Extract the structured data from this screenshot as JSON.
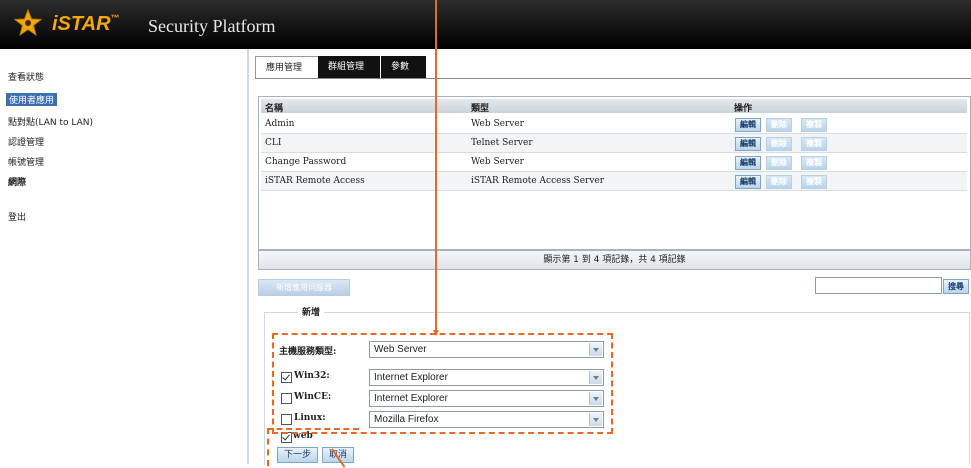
{
  "app": {
    "brand": "iSTAR",
    "tm": "™",
    "product": "Security Platform"
  },
  "sidebar": {
    "items": [
      {
        "label": "查看狀態"
      },
      {
        "label": "使用者應用"
      },
      {
        "label": "點對點(LAN to LAN)"
      },
      {
        "label": "認證管理"
      },
      {
        "label": "帳號管理"
      },
      {
        "label": "網際"
      },
      {
        "label": "登出"
      }
    ]
  },
  "tabs": [
    {
      "label": "應用管理"
    },
    {
      "label": "群組管理"
    },
    {
      "label": "參數"
    }
  ],
  "table": {
    "headers": [
      "名稱",
      "類型",
      "操作"
    ],
    "rows": [
      {
        "name": "Admin",
        "type": "Web Server"
      },
      {
        "name": "CLI",
        "type": "Telnet Server"
      },
      {
        "name": "Change Password",
        "type": "Web Server"
      },
      {
        "name": "iSTAR Remote Access",
        "type": "iSTAR Remote Access Server"
      }
    ],
    "actions": {
      "edit": "編輯",
      "delete": "刪除",
      "copy": "複製"
    }
  },
  "pager": {
    "text": "顯示第 1 到 4 項記錄，共 4 項記錄"
  },
  "toolbar": {
    "add_app": "新增應用伺服器",
    "search_button": "搜尋",
    "search_value": ""
  },
  "form": {
    "section_title": "新增",
    "server_type_label": "主機服務類型:",
    "server_type_value": "Web Server",
    "platforms": [
      {
        "label": "Win32:",
        "checked": true,
        "value": "Internet Explorer"
      },
      {
        "label": "WinCE:",
        "checked": false,
        "value": "Internet Explorer"
      },
      {
        "label": "Linux:",
        "checked": false,
        "value": "Mozilla Firefox"
      }
    ],
    "web_label": "web",
    "web_checked": true,
    "next_button": "下一步",
    "cancel_button": "取消"
  },
  "colors": {
    "accent": "#e46a2a",
    "brand": "#f5a800",
    "active_nav": "#3f6fb3"
  }
}
